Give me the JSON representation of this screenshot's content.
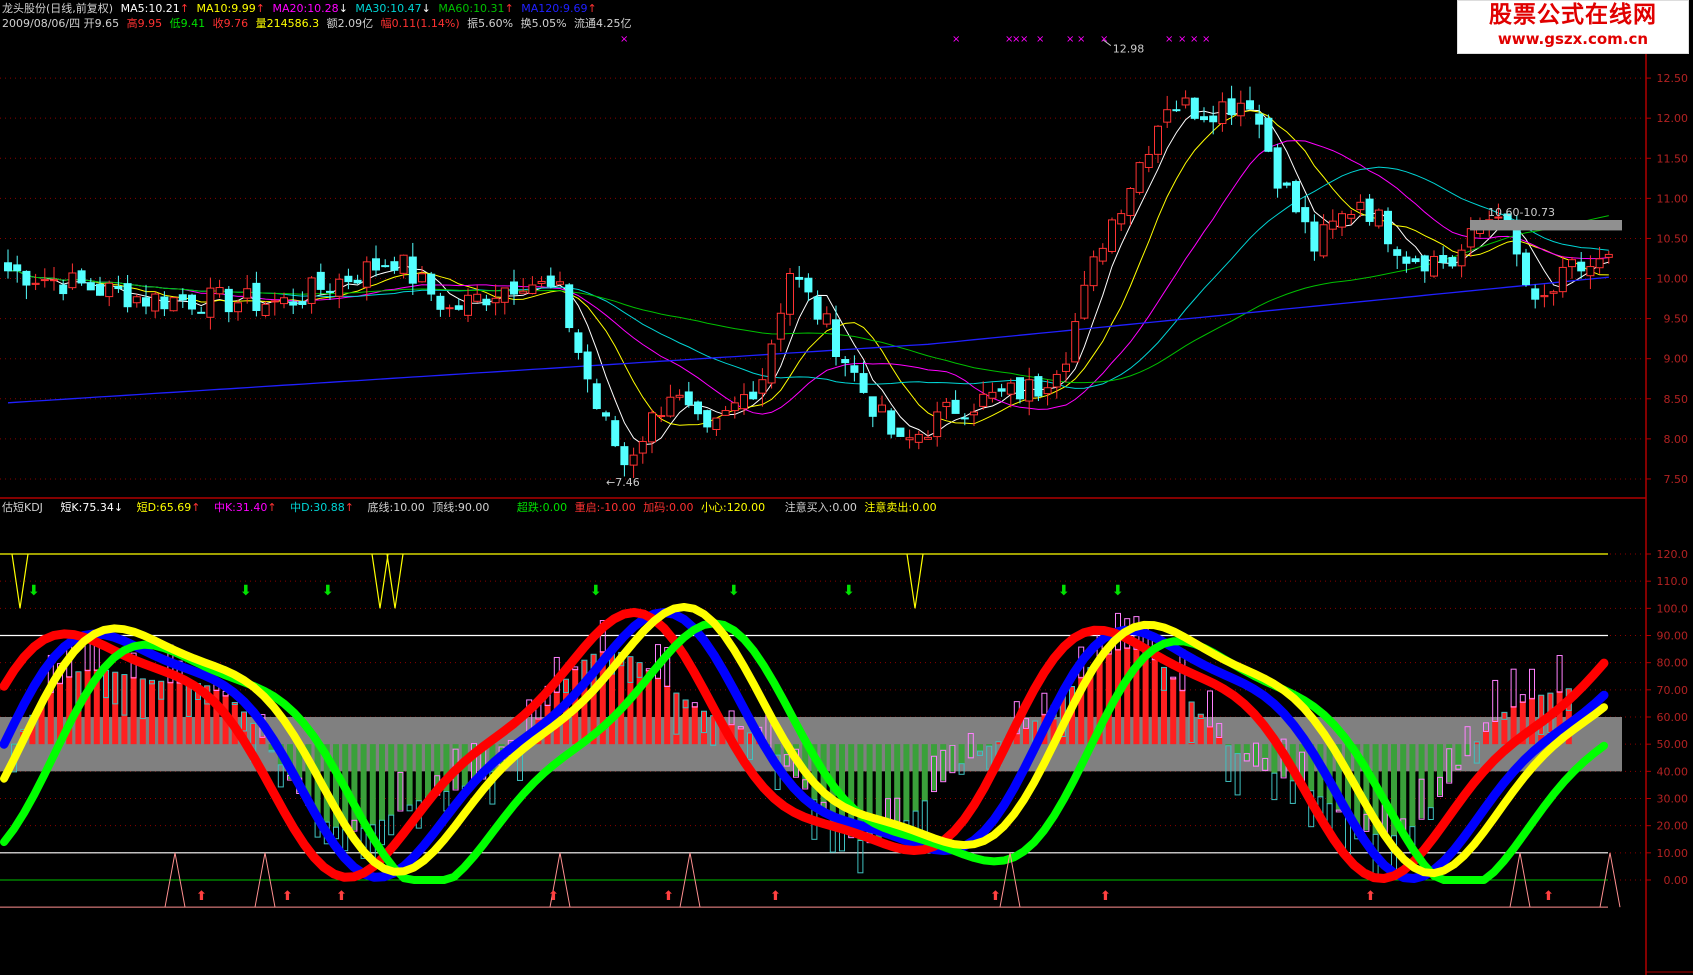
{
  "header": {
    "stock": "龙头股份(日线,前复权)",
    "ma5": "MA5:10.21",
    "ma10": "MA10:9.99",
    "ma20": "MA20:10.28",
    "ma30": "MA30:10.47",
    "ma60": "MA60:10.31",
    "ma120": "MA120:9.69",
    "date_open": "2009/08/06/四 开9.65",
    "high": "高9.95",
    "low": "低9.41",
    "close": "收9.76",
    "volume": "量214586.3",
    "amount": "额2.09亿",
    "change": "幅0.11(1.14%)",
    "amplitude": "振5.60%",
    "turnover": "换5.05%",
    "float": "流通4.25亿"
  },
  "indicator_bar": {
    "name": "估短KDJ",
    "short_k": "短K:75.34",
    "short_d": "短D:65.69",
    "mid_k": "中K:31.40",
    "mid_d": "中D:30.88",
    "floor": "底线:10.00",
    "top": "顶线:90.00",
    "oversold": "超跌:0.00",
    "restart": "重启:-10.00",
    "add": "加码:0.00",
    "careful": "小心:120.00",
    "watch_buy": "注意买入:0.00",
    "watch_sell": "注意卖出:0.00"
  },
  "watermark": {
    "title": "股票公式在线网",
    "url": "www.gszx.com.cn"
  },
  "price_axis": {
    "ticks": [
      "12.50",
      "12.00",
      "11.50",
      "11.00",
      "10.50",
      "10.00",
      "9.50",
      "9.00",
      "8.50",
      "8.00",
      "7.50"
    ],
    "min": 7.3,
    "max": 13.0
  },
  "indicator_axis": {
    "ticks": [
      "120.0",
      "110.0",
      "100.0",
      "90.00",
      "80.00",
      "70.00",
      "60.00",
      "50.00",
      "40.00",
      "30.00",
      "20.00",
      "10.00",
      "0.00"
    ],
    "min": 0,
    "max": 120
  },
  "annotations": {
    "peak_price": "12.98",
    "low_price": "7.46",
    "range_label": "10.60-10.73"
  },
  "colors": {
    "up": "#ff3232",
    "down": "#54ffff",
    "ma5": "#ffffff",
    "ma10": "#ffff00",
    "ma20": "#ff00ff",
    "ma30": "#00d5d5",
    "ma60": "#00c000",
    "ma120": "#2020ff",
    "grid": "#8b0000"
  }
}
